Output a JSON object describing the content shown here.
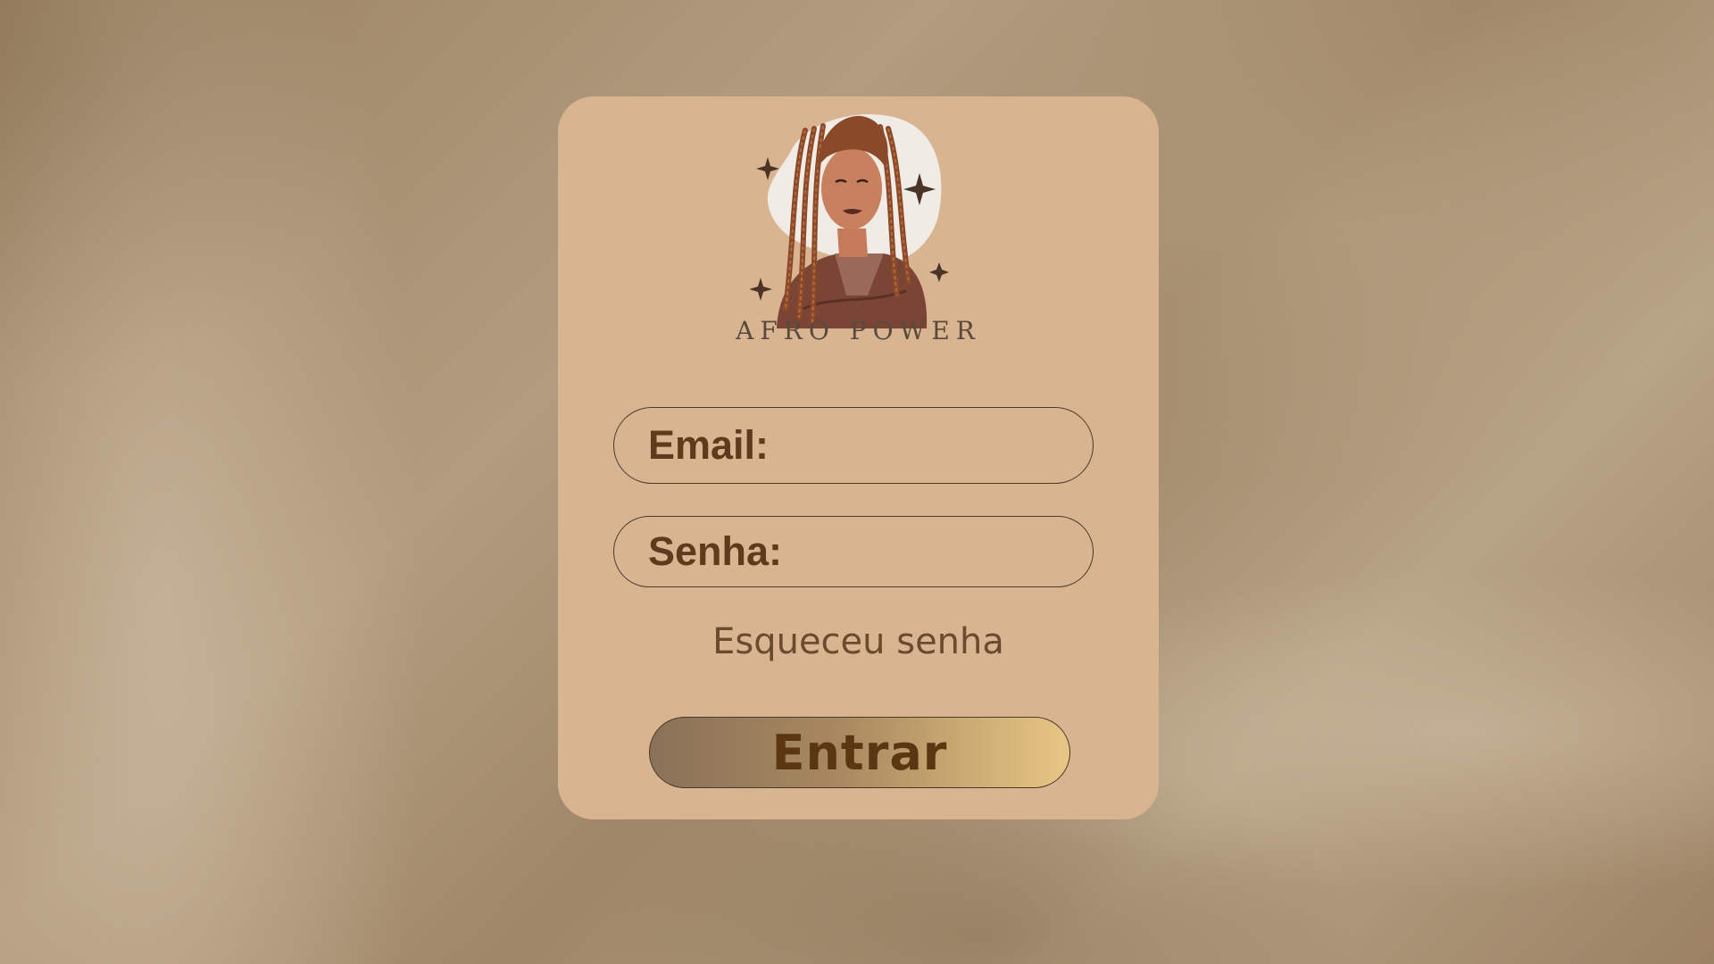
{
  "brand": {
    "name": "AFRO POWER"
  },
  "form": {
    "email_label": "Email:",
    "password_label": "Senha:",
    "forgot_link": "Esqueceu senha",
    "submit_label": "Entrar"
  },
  "colors": {
    "card": "#d9b490",
    "label_text": "#5e3b1d",
    "button_gradient_start": "#8a7158",
    "button_gradient_end": "#e8c684"
  },
  "icons": {
    "logo": "woman-with-braids-illustration"
  }
}
